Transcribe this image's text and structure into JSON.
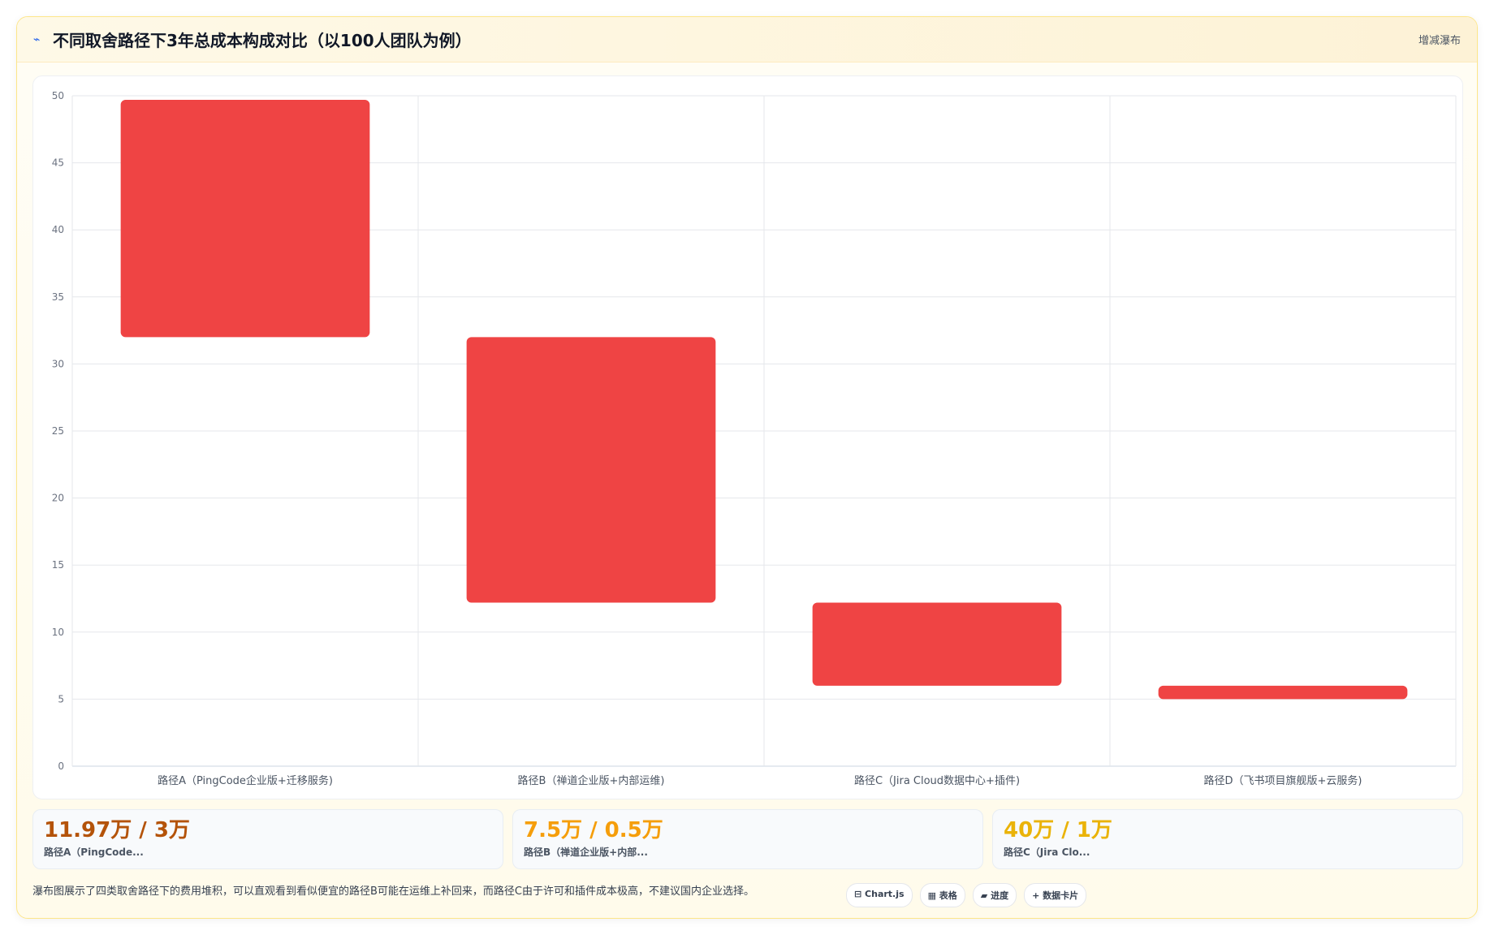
{
  "header": {
    "icon": "trend-icon",
    "title": "不同取舍路径下3年总成本构成对比（以100人团队为例）",
    "action_label": "增减瀑布"
  },
  "chart_data": {
    "type": "bar",
    "subtype": "waterfall",
    "title": "",
    "xlabel": "",
    "ylabel": "",
    "ylim": [
      0,
      50
    ],
    "yticks": [
      0,
      5,
      10,
      15,
      20,
      25,
      30,
      35,
      40,
      45,
      50
    ],
    "grid": true,
    "categories": [
      "路径A（PingCode企业版+迁移服务)",
      "路径B（禅道企业版+内部运维)",
      "路径C（Jira Cloud数据中心+插件)",
      "路径D（飞书项目旗舰版+云服务)"
    ],
    "ranges": [
      [
        32,
        49.7
      ],
      [
        12.2,
        32
      ],
      [
        6,
        12.2
      ],
      [
        5,
        6
      ]
    ],
    "color": "#ef4444"
  },
  "stats": [
    {
      "value": "11.97万 / 3万",
      "label": "路径A（PingCode...",
      "color": "#b45309"
    },
    {
      "value": "7.5万 / 0.5万",
      "label": "路径B（禅道企业版+内部...",
      "color": "#f59e0b"
    },
    {
      "value": "40万 / 1万",
      "label": "路径C（Jira Clo...",
      "color": "#eab308"
    }
  ],
  "footer": {
    "text": "瀑布图展示了四类取舍路径下的费用堆积，可以直观看到看似便宜的路径B可能在运维上补回来，而路径C由于许可和插件成本极高，不建议国内企业选择。",
    "chips": [
      "⊟ Chart.js",
      "▦ 表格",
      "▰ 进度",
      "+ 数据卡片"
    ]
  }
}
